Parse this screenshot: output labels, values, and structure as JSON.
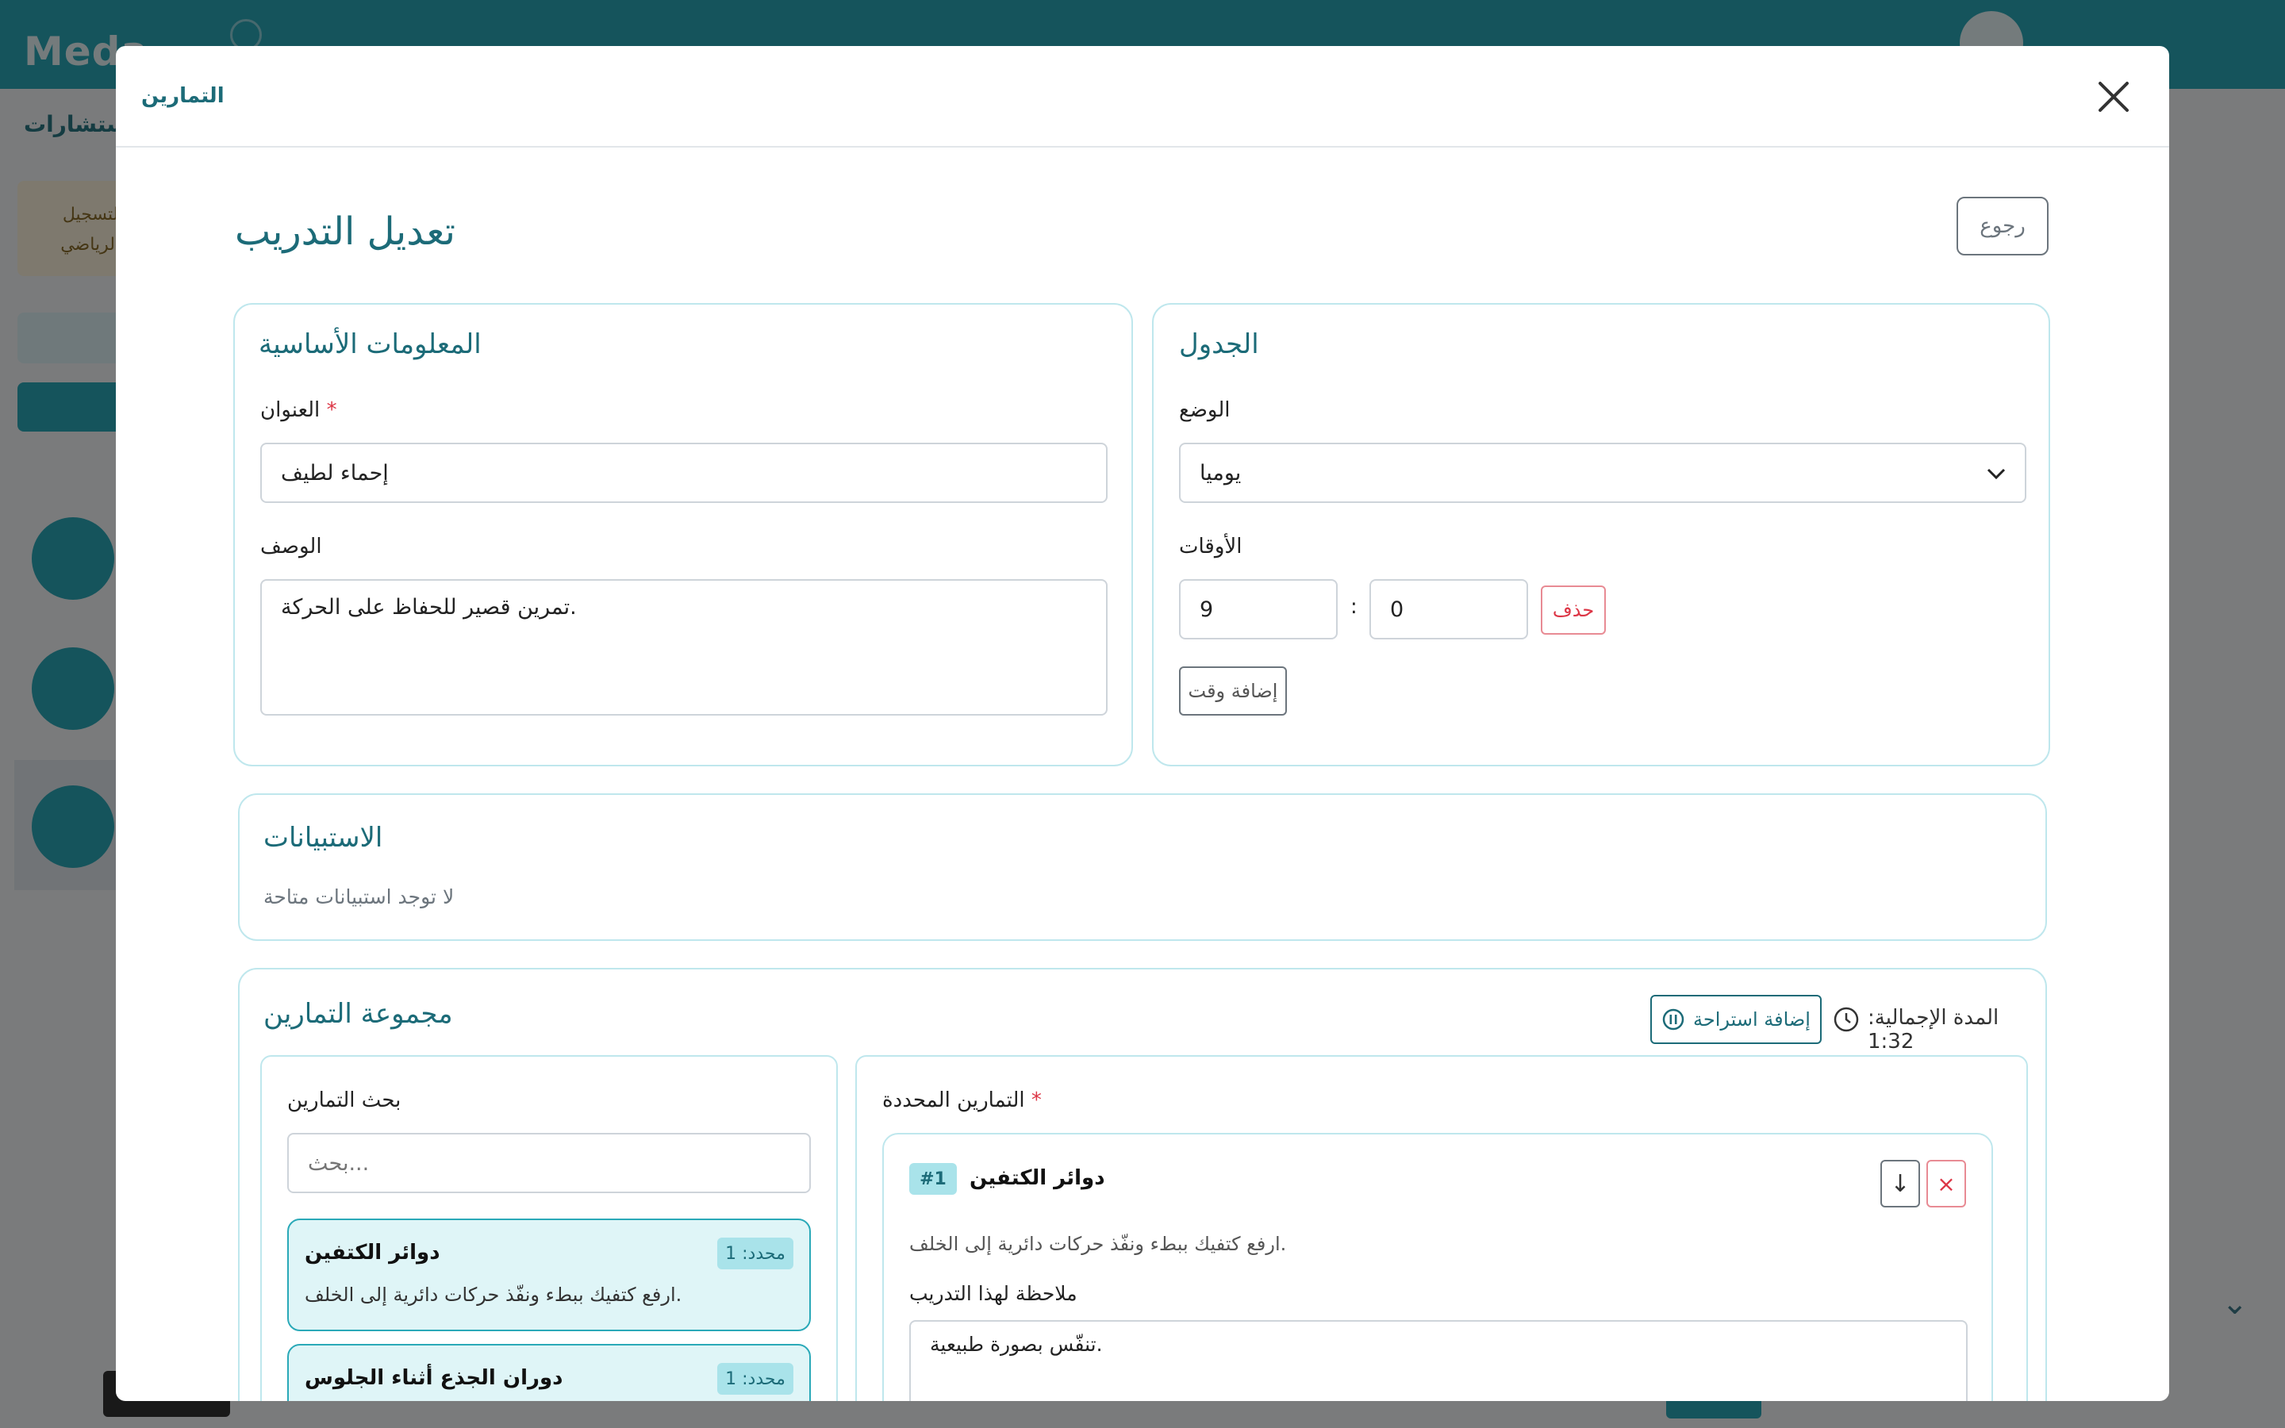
{
  "background": {
    "logo": "Meda",
    "subtitle": "الاستشارات",
    "note_line1": "ة التسجيل",
    "note_line2": "ل الرياضي"
  },
  "modal": {
    "header_title": "التمارين",
    "close_icon": "close-icon",
    "page_title": "تعديل التدريب",
    "back_label": "رجوع"
  },
  "basic_info": {
    "title": "المعلومات الأساسية",
    "title_label": "العنوان",
    "title_value": "إحماء لطيف",
    "desc_label": "الوصف",
    "desc_value": "تمرين قصير للحفاظ على الحركة."
  },
  "schedule": {
    "title": "الجدول",
    "mode_label": "الوضع",
    "mode_value": "يوميا",
    "times_label": "الأوقات",
    "hour": "9",
    "minute": "0",
    "sep": ":",
    "delete_label": "حذف",
    "add_time_label": "إضافة وقت"
  },
  "questionnaires": {
    "title": "الاستبيانات",
    "empty": "لا توجد استبيانات متاحة"
  },
  "exercises": {
    "title": "مجموعة التمارين",
    "total_duration": "المدة الإجمالية: 1:32",
    "add_rest_label": "إضافة استراحة",
    "search_title": "بحث التمارين",
    "search_placeholder": "بحث...",
    "list": [
      {
        "name": "دوائر الكتفين",
        "badge": "محدد: 1",
        "desc": "ارفع كتفيك ببطء ونفّذ حركات دائرية إلى الخلف."
      },
      {
        "name": "دوران الجذع أثناء الجلوس",
        "badge": "محدد: 1",
        "desc": ""
      }
    ],
    "selected_title": "التمارين المحددة",
    "selected": [
      {
        "name": "دوائر الكتفين",
        "index": "#1",
        "desc": "ارفع كتفيك ببطء ونفّذ حركات دائرية إلى الخلف.",
        "note_label": "ملاحظة لهذا التدريب",
        "note_value": "تنفّس بصورة طبيعية."
      }
    ],
    "down_arrow": "↓",
    "remove_x": "×"
  },
  "colors": {
    "teal": "#1c6b78",
    "accent": "#2aa9b8",
    "danger": "#dc3545"
  }
}
